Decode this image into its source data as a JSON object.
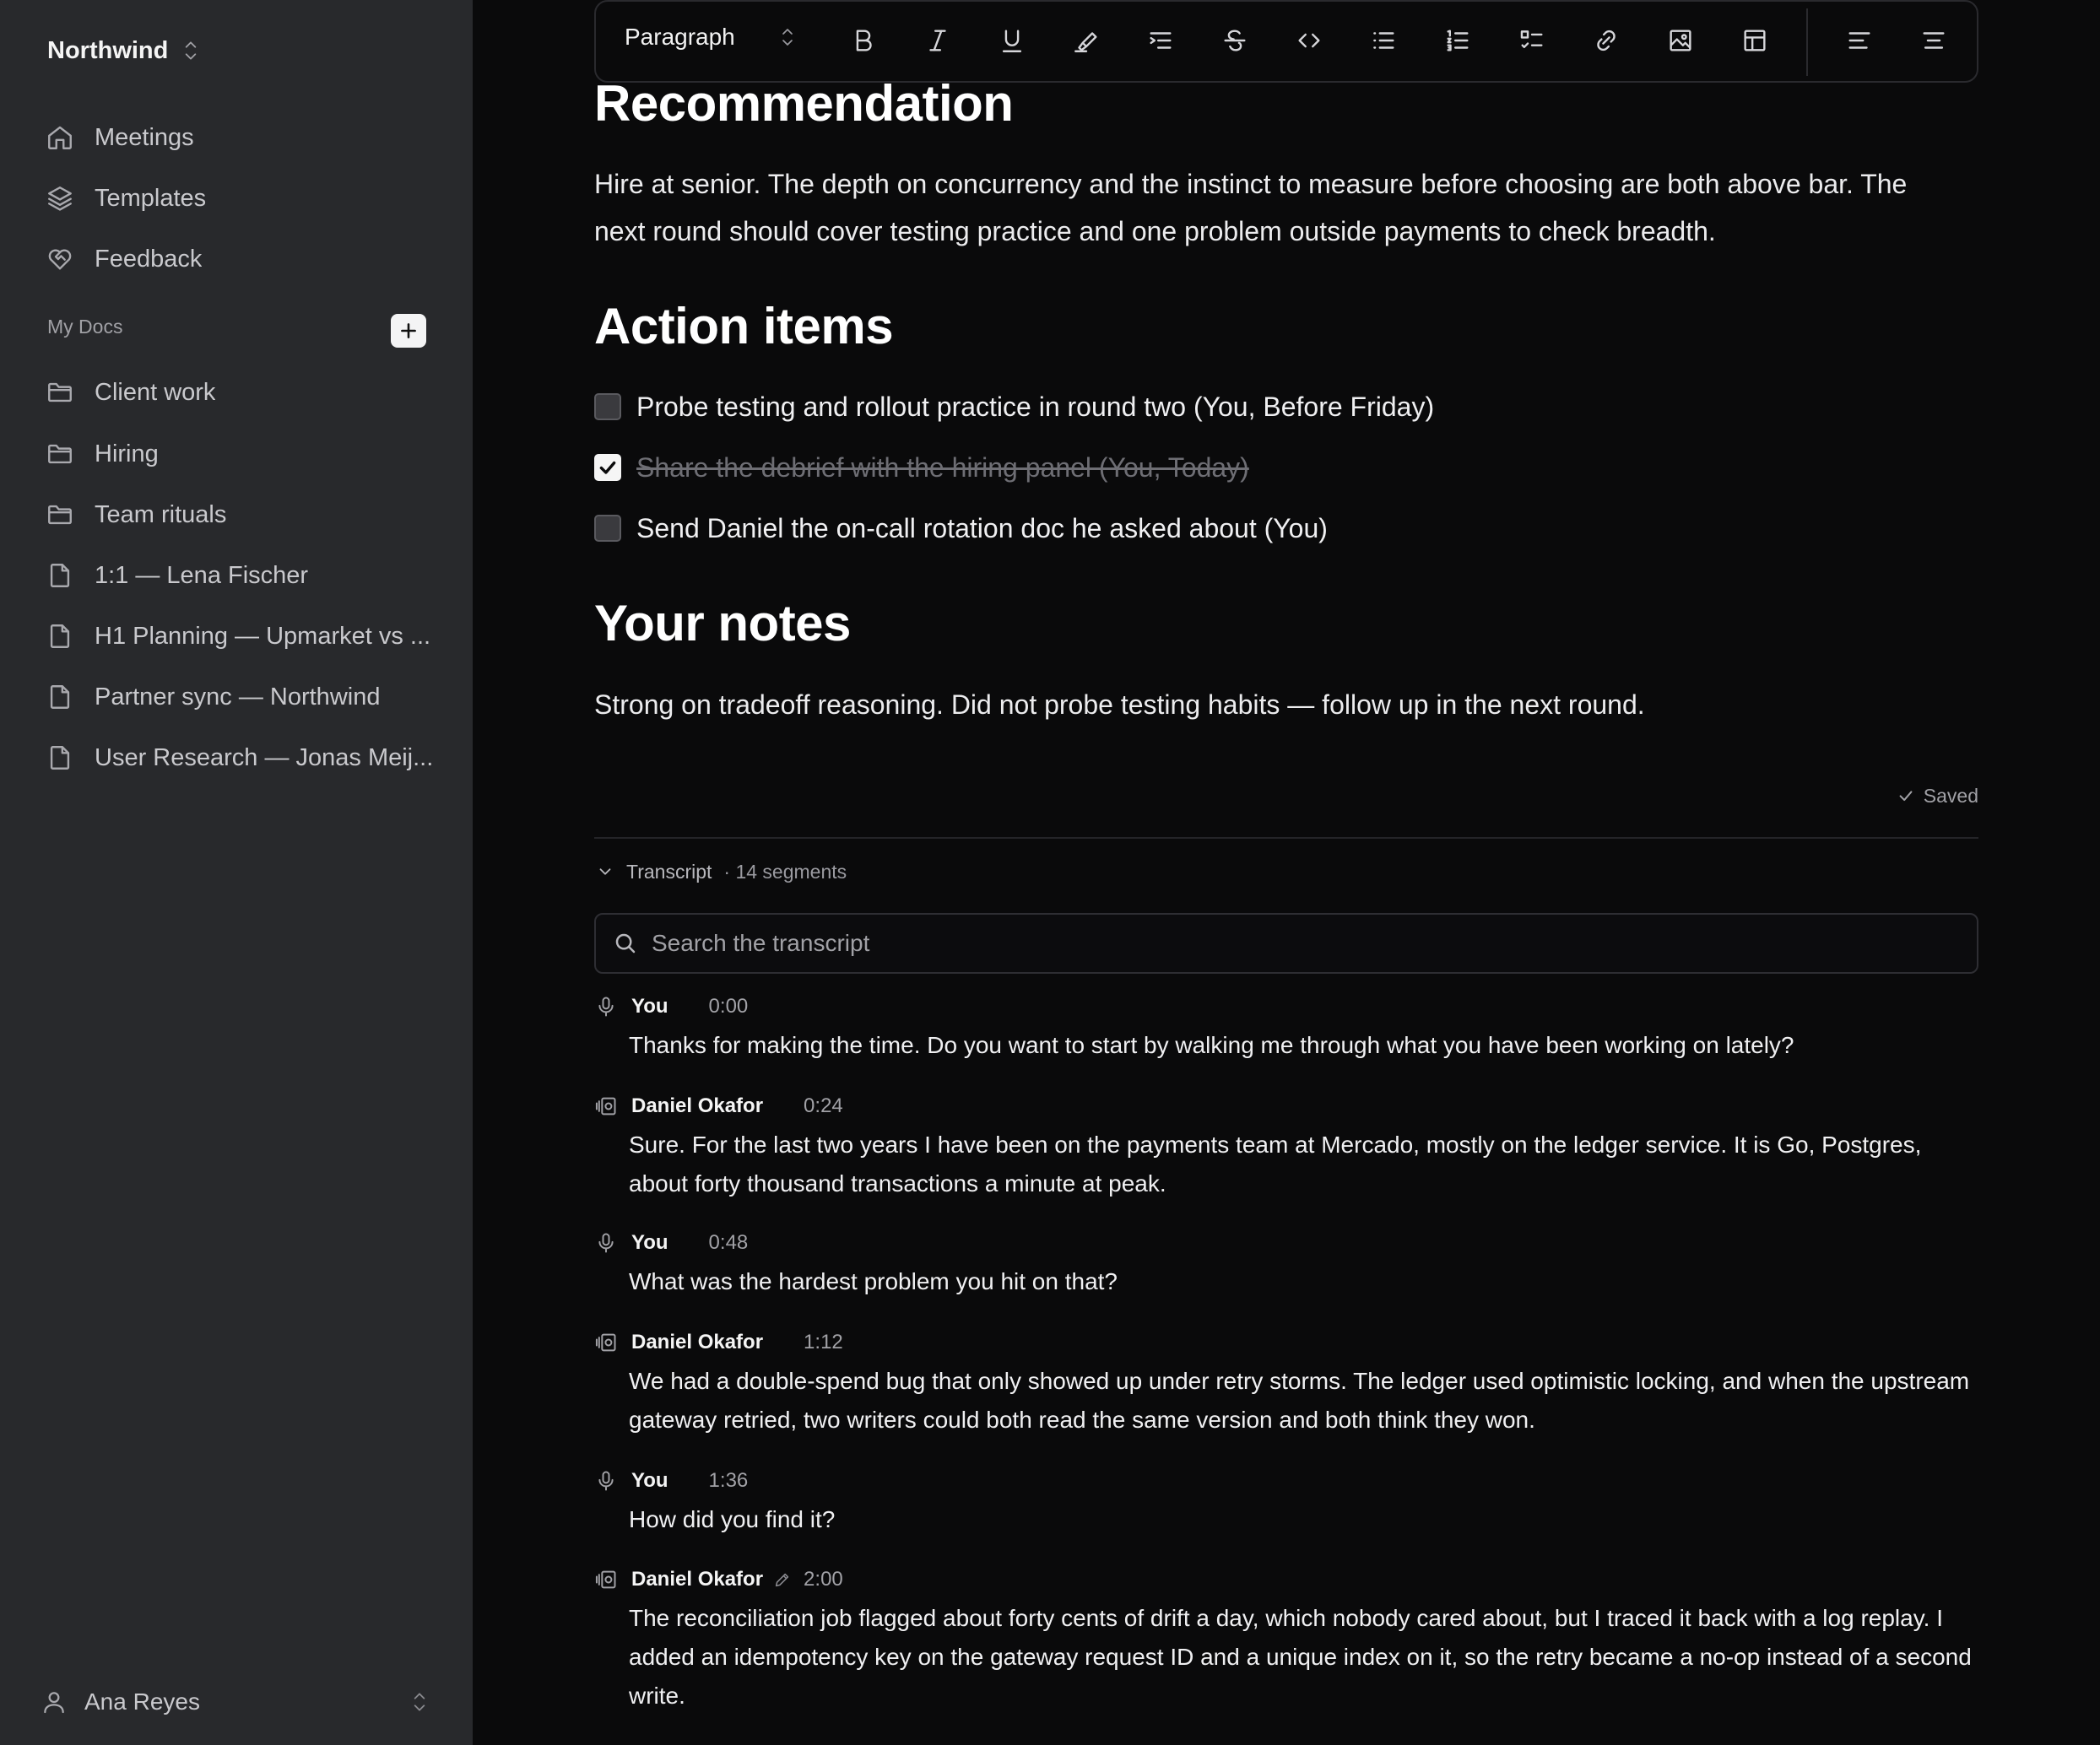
{
  "sidebar": {
    "workspace": "Northwind",
    "nav": [
      {
        "label": "Meetings",
        "icon": "home-icon"
      },
      {
        "label": "Templates",
        "icon": "layers-icon"
      },
      {
        "label": "Feedback",
        "icon": "heart-handshake-icon"
      }
    ],
    "section_label": "My Docs",
    "docs": [
      {
        "label": "Client work",
        "icon": "folder-icon"
      },
      {
        "label": "Hiring",
        "icon": "folder-icon"
      },
      {
        "label": "Team rituals",
        "icon": "folder-icon"
      },
      {
        "label": "1:1 — Lena Fischer",
        "icon": "file-icon"
      },
      {
        "label": "H1 Planning — Upmarket vs ...",
        "icon": "file-icon"
      },
      {
        "label": "Partner sync — Northwind",
        "icon": "file-icon"
      },
      {
        "label": "User Research — Jonas Meij...",
        "icon": "file-icon"
      }
    ],
    "user": "Ana Reyes"
  },
  "toolbar": {
    "block_type": "Paragraph",
    "tools": [
      "bold-icon",
      "italic-icon",
      "underline-icon",
      "highlight-icon",
      "indent-icon",
      "strikethrough-icon",
      "code-icon",
      "bullet-list-icon",
      "numbered-list-icon",
      "checklist-icon",
      "link-icon",
      "image-icon",
      "table-icon",
      "align-left-icon",
      "align-center-icon"
    ]
  },
  "doc": {
    "recommendation_heading": "Recommendation",
    "recommendation_text": "Hire at senior. The depth on concurrency and the instinct to measure before choosing are both above bar. The next round should cover testing practice and one problem outside payments to check breadth.",
    "action_heading": "Action items",
    "tasks": [
      {
        "label": "Probe testing and rollout practice in round two (You, Before Friday)",
        "done": false
      },
      {
        "label": "Share the debrief with the hiring panel (You, Today)",
        "done": true
      },
      {
        "label": "Send Daniel the on-call rotation doc he asked about (You)",
        "done": false
      }
    ],
    "notes_heading": "Your notes",
    "notes_text": "Strong on tradeoff reasoning. Did not probe testing habits — follow up in the next round.",
    "saved_label": "Saved"
  },
  "transcript": {
    "label": "Transcript",
    "count": "· 14 segments",
    "search_placeholder": "Search the transcript",
    "segments": [
      {
        "speaker": "You",
        "time": "0:00",
        "icon": "microphone-icon",
        "text": "Thanks for making the time. Do you want to start by walking me through what you have been working on lately?"
      },
      {
        "speaker": "Daniel Okafor",
        "time": "0:24",
        "icon": "speaker-icon",
        "text": "Sure. For the last two years I have been on the payments team at Mercado, mostly on the ledger service. It is Go, Postgres, about forty thousand transactions a minute at peak."
      },
      {
        "speaker": "You",
        "time": "0:48",
        "icon": "microphone-icon",
        "text": "What was the hardest problem you hit on that?"
      },
      {
        "speaker": "Daniel Okafor",
        "time": "1:12",
        "icon": "speaker-icon",
        "text": "We had a double-spend bug that only showed up under retry storms. The ledger used optimistic locking, and when the upstream gateway retried, two writers could both read the same version and both think they won."
      },
      {
        "speaker": "You",
        "time": "1:36",
        "icon": "microphone-icon",
        "text": "How did you find it?"
      },
      {
        "speaker": "Daniel Okafor",
        "time": "2:00",
        "icon": "speaker-icon",
        "edited": true,
        "text": "The reconciliation job flagged about forty cents of drift a day, which nobody cared about, but I traced it back with a log replay. I added an idempotency key on the gateway request ID and a unique index on it, so the retry became a no-op instead of a second write."
      }
    ]
  }
}
